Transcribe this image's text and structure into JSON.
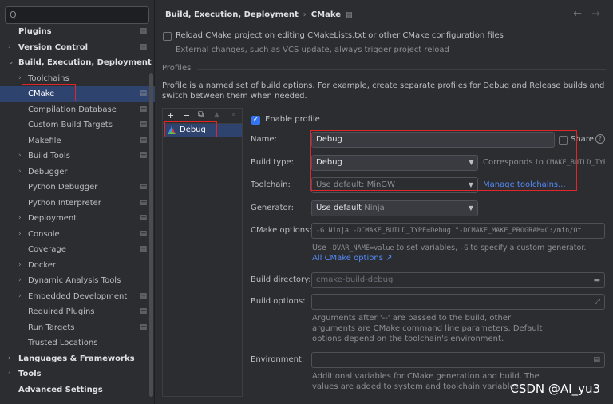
{
  "sidebar": {
    "search_glyph": "Q",
    "items": [
      {
        "label": "Plugins",
        "arrow": "",
        "bold": true,
        "mark": "▤"
      },
      {
        "label": "Version Control",
        "arrow": "›",
        "bold": true,
        "mark": "▤"
      },
      {
        "label": "Build, Execution, Deployment",
        "arrow": "⌄",
        "bold": true,
        "mark": ""
      },
      {
        "label": "Toolchains",
        "arrow": "›",
        "bold": false,
        "mark": ""
      },
      {
        "label": "CMake",
        "arrow": "",
        "bold": false,
        "mark": "▤"
      },
      {
        "label": "Compilation Database",
        "arrow": "",
        "bold": false,
        "mark": "▤"
      },
      {
        "label": "Custom Build Targets",
        "arrow": "",
        "bold": false,
        "mark": "▤"
      },
      {
        "label": "Makefile",
        "arrow": "",
        "bold": false,
        "mark": "▤"
      },
      {
        "label": "Build Tools",
        "arrow": "›",
        "bold": false,
        "mark": "▤"
      },
      {
        "label": "Debugger",
        "arrow": "›",
        "bold": false,
        "mark": ""
      },
      {
        "label": "Python Debugger",
        "arrow": "",
        "bold": false,
        "mark": "▤"
      },
      {
        "label": "Python Interpreter",
        "arrow": "",
        "bold": false,
        "mark": "▤"
      },
      {
        "label": "Deployment",
        "arrow": "›",
        "bold": false,
        "mark": "▤"
      },
      {
        "label": "Console",
        "arrow": "›",
        "bold": false,
        "mark": "▤"
      },
      {
        "label": "Coverage",
        "arrow": "",
        "bold": false,
        "mark": "▤"
      },
      {
        "label": "Docker",
        "arrow": "›",
        "bold": false,
        "mark": ""
      },
      {
        "label": "Dynamic Analysis Tools",
        "arrow": "›",
        "bold": false,
        "mark": ""
      },
      {
        "label": "Embedded Development",
        "arrow": "›",
        "bold": false,
        "mark": "▤"
      },
      {
        "label": "Required Plugins",
        "arrow": "",
        "bold": false,
        "mark": "▤"
      },
      {
        "label": "Run Targets",
        "arrow": "",
        "bold": false,
        "mark": "▤"
      },
      {
        "label": "Trusted Locations",
        "arrow": "",
        "bold": false,
        "mark": ""
      },
      {
        "label": "Languages & Frameworks",
        "arrow": "›",
        "bold": true,
        "mark": ""
      },
      {
        "label": "Tools",
        "arrow": "›",
        "bold": true,
        "mark": ""
      },
      {
        "label": "Advanced Settings",
        "arrow": "",
        "bold": true,
        "mark": ""
      }
    ]
  },
  "header": {
    "crumb_parent": "Build, Execution, Deployment",
    "crumb_sep": "›",
    "crumb_current": "CMake",
    "crumb_doc": "▤",
    "back": "←",
    "forward": "→"
  },
  "reload": {
    "label": "Reload CMake project on editing CMakeLists.txt or other CMake configuration files",
    "hint": "External changes, such as VCS update, always trigger project reload"
  },
  "profiles": {
    "section": "Profiles",
    "description": "Profile is a named set of build options. For example, create separate profiles for Debug and Release builds and switch between them when needed.",
    "toolbar": {
      "add": "+",
      "remove": "−",
      "copy": "⧉",
      "up": "▲",
      "down": "»"
    },
    "list": [
      "Debug"
    ]
  },
  "form": {
    "enable_profile": "Enable profile",
    "name_label": "Name:",
    "name_value": "Debug",
    "share_label": "Share",
    "help_glyph": "?",
    "build_type_label": "Build type:",
    "build_type_value": "Debug",
    "corresponds_prefix": "Corresponds to",
    "corresponds_code": "CMAKE_BUILD_TYPE",
    "toolchain_label": "Toolchain:",
    "toolchain_value": "Use default: MinGW",
    "manage_toolchains": "Manage toolchains...",
    "generator_label": "Generator:",
    "generator_value_main": "Use default",
    "generator_value_sub": "Ninja",
    "cmake_options_label": "CMake options:",
    "cmake_options_value": "-G Ninja -DCMAKE_BUILD_TYPE=Debug \"-DCMAKE_MAKE_PROGRAM=C:/min/Ot",
    "cmake_hint_pre": "Use",
    "cmake_hint_code1": "-DVAR_NAME=value",
    "cmake_hint_mid": "to set variables,",
    "cmake_hint_code2": "-G",
    "cmake_hint_post": "to specify a custom generator.",
    "all_cmake_options": "All CMake options ↗",
    "build_dir_label": "Build directory:",
    "build_dir_placeholder": "cmake-build-debug",
    "build_options_label": "Build options:",
    "build_options_hint": "Arguments after '--' are passed to the build, other arguments are CMake command line parameters. Default options depend on the toolchain's environment.",
    "environment_label": "Environment:",
    "environment_hint": "Additional variables for CMake generation and build. The values are added to system and toolchain variables."
  },
  "watermark": "CSDN @AI_yu3",
  "colors": {
    "accent": "#3574f0",
    "selection": "#2e436e",
    "link": "#548af7",
    "highlight_box": "#e0262a"
  }
}
